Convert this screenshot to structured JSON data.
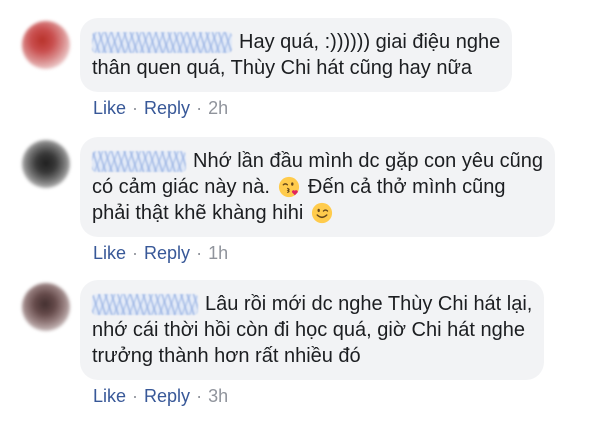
{
  "comments": [
    {
      "lines": [
        [
          {
            "text": "Hay quá, :)))))) giai điệu nghe"
          }
        ],
        [
          {
            "text": "thân quen quá, Thùy Chi hát cũng hay nữa"
          }
        ]
      ],
      "actions": {
        "like": "Like",
        "reply": "Reply",
        "time": "2h"
      }
    },
    {
      "lines": [
        [
          {
            "text": "Nhớ lần đầu mình dc gặp con yêu cũng"
          }
        ],
        [
          {
            "text": "có cảm giác này nà."
          },
          {
            "icon": "face-blowing-a-kiss-icon"
          },
          {
            "text": "Đến cả thở mình cũng"
          }
        ],
        [
          {
            "text": "phải thật khẽ khàng hihi"
          },
          {
            "icon": "winking-face-icon"
          }
        ]
      ],
      "actions": {
        "like": "Like",
        "reply": "Reply",
        "time": "1h"
      }
    },
    {
      "lines": [
        [
          {
            "text": "Lâu rồi mới dc nghe Thùy Chi hát lại,"
          }
        ],
        [
          {
            "text": "nhớ cái thời hồi còn đi học quá, giờ Chi hát nghe"
          }
        ],
        [
          {
            "text": "trưởng thành hơn rất nhiều đó"
          }
        ]
      ],
      "actions": {
        "like": "Like",
        "reply": "Reply",
        "time": "3h"
      }
    }
  ],
  "separator": "·",
  "colors": {
    "bubble": "#f2f3f5",
    "text": "#1c1e21",
    "link": "#385898",
    "meta": "#90949c"
  }
}
